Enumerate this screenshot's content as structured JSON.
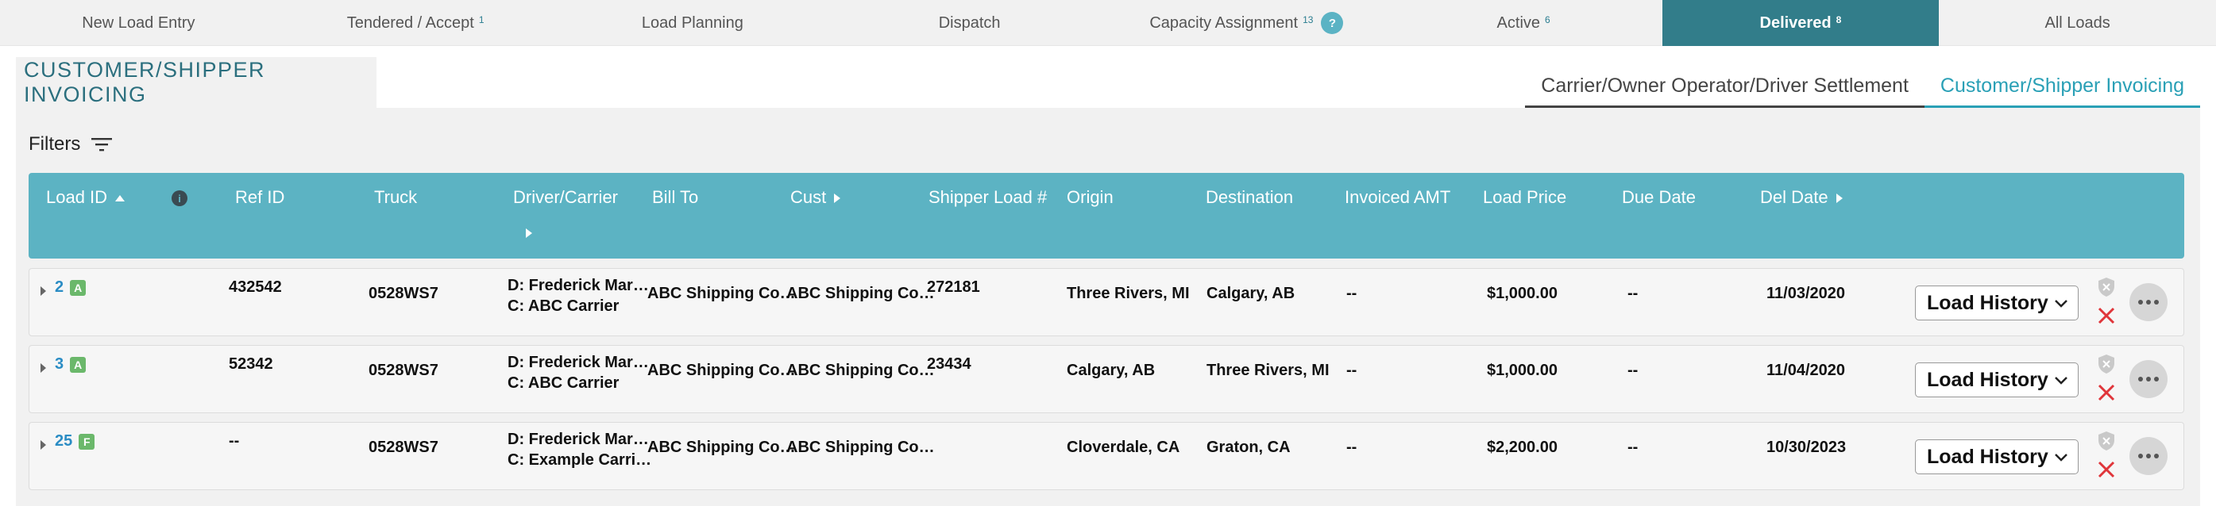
{
  "nav": {
    "items": [
      {
        "label": "New Load Entry",
        "count": ""
      },
      {
        "label": "Tendered / Accept",
        "count": "1"
      },
      {
        "label": "Load Planning",
        "count": ""
      },
      {
        "label": "Dispatch",
        "count": ""
      },
      {
        "label": "Capacity Assignment",
        "count": "13",
        "help": "?"
      },
      {
        "label": "Active",
        "count": "6"
      },
      {
        "label": "Delivered",
        "count": "8"
      },
      {
        "label": "All Loads",
        "count": ""
      }
    ],
    "active_index": 6
  },
  "page": {
    "title": "CUSTOMER/SHIPPER INVOICING",
    "right_tabs": [
      "Carrier/Owner Operator/Driver Settlement",
      "Customer/Shipper Invoicing"
    ],
    "filters_label": "Filters"
  },
  "table": {
    "headers": {
      "load_id": "Load ID",
      "ref_id": "Ref ID",
      "truck": "Truck",
      "driver": "Driver/Carrier",
      "bill_to": "Bill To",
      "cust": "Cust",
      "shipper_load": "Shipper Load #",
      "origin": "Origin",
      "destination": "Destination",
      "invoiced": "Invoiced AMT",
      "load_price": "Load Price",
      "due_date": "Due Date",
      "del_date": "Del Date"
    },
    "rows": [
      {
        "load_id": "2",
        "badge": "A",
        "ref_id": "432542",
        "truck": "0528WS7",
        "driver": "D: Frederick Mar…",
        "carrier": "C: ABC Carrier",
        "bill_to": "ABC Shipping Co…",
        "cust": "ABC Shipping Co…",
        "shipper_load": "272181",
        "origin": "Three Rivers, MI",
        "destination": "Calgary, AB",
        "invoiced": "--",
        "load_price": "$1,000.00",
        "due_date": "--",
        "del_date": "11/03/2020",
        "action": "Load History"
      },
      {
        "load_id": "3",
        "badge": "A",
        "ref_id": "52342",
        "truck": "0528WS7",
        "driver": "D: Frederick Mar…",
        "carrier": "C: ABC Carrier",
        "bill_to": "ABC Shipping Co…",
        "cust": "ABC Shipping Co…",
        "shipper_load": "23434",
        "origin": "Calgary, AB",
        "destination": "Three Rivers, MI",
        "invoiced": "--",
        "load_price": "$1,000.00",
        "due_date": "--",
        "del_date": "11/04/2020",
        "action": "Load History"
      },
      {
        "load_id": "25",
        "badge": "F",
        "ref_id": "--",
        "truck": "0528WS7",
        "driver": "D: Frederick Mar…",
        "carrier": "C: Example Carri…",
        "bill_to": "ABC Shipping Co…",
        "cust": "ABC Shipping Co…",
        "shipper_load": "",
        "origin": "Cloverdale, CA",
        "destination": "Graton, CA",
        "invoiced": "--",
        "load_price": "$2,200.00",
        "due_date": "--",
        "del_date": "10/30/2023",
        "action": "Load History"
      }
    ]
  },
  "colors": {
    "accent": "#327d8a",
    "header_bg": "#5cb3c3",
    "link": "#2a8cc4",
    "badge": "#6bb86b",
    "danger": "#e0353a"
  }
}
